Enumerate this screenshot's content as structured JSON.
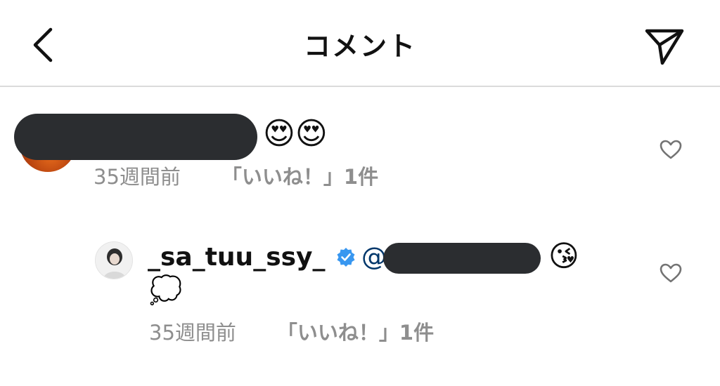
{
  "header": {
    "title": "コメント"
  },
  "comments": [
    {
      "text_emojis": "😍😍",
      "time": "35週間前",
      "likes": "「いいね！」1件"
    }
  ],
  "reply": {
    "username": "_sa_tuu_ssy_",
    "mention_prefix": "@",
    "emoji_inline": "😘",
    "emoji_line2": "💭",
    "time": "35週間前",
    "likes": "「いいね！」1件"
  },
  "colors": {
    "verified": "#3897f0",
    "mention": "#00376b",
    "meta_gray": "#8e8e8e",
    "redaction": "#2b2d30",
    "divider": "#dbdbdb"
  },
  "icons": {
    "back": "chevron-left-icon",
    "send": "paper-plane-icon",
    "like": "heart-outline-icon",
    "verified": "verified-badge-icon"
  }
}
